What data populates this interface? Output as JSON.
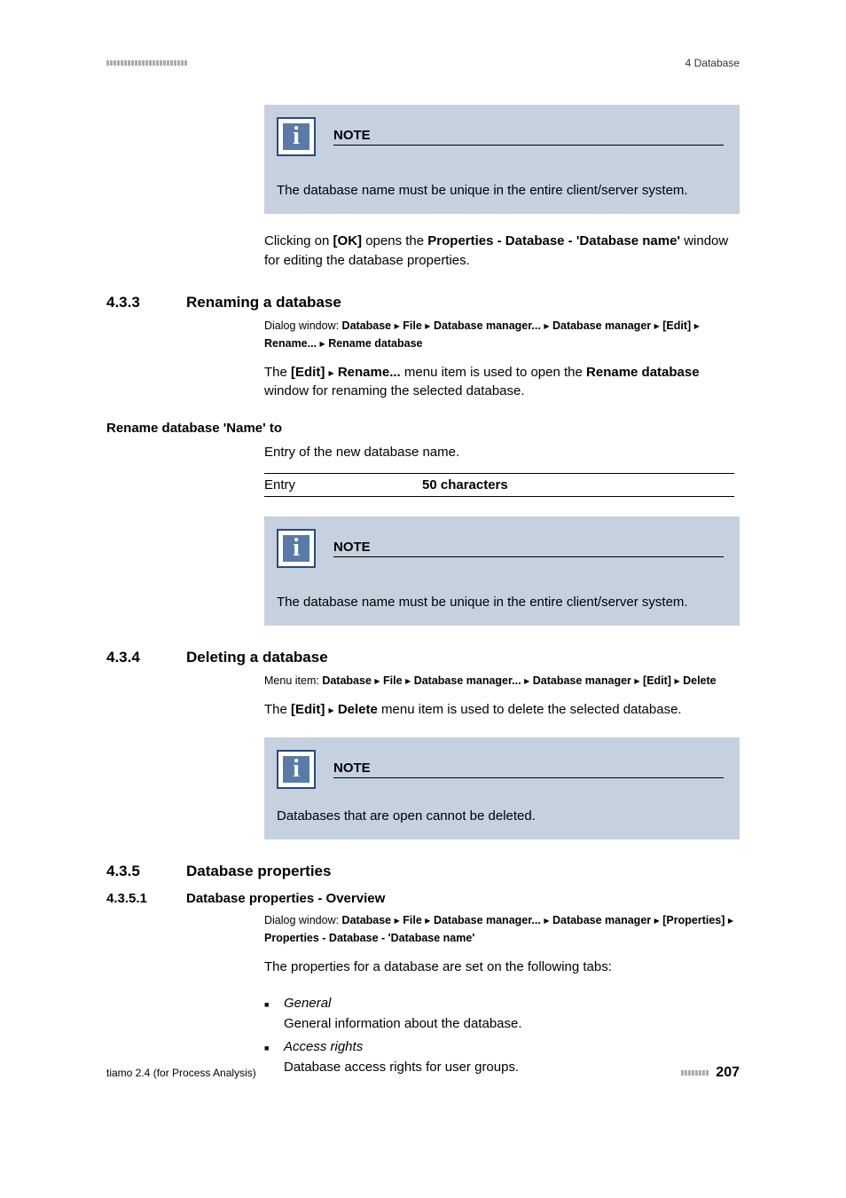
{
  "header": {
    "right": "4 Database"
  },
  "note1": {
    "title": "NOTE",
    "body": "The database name must be unique in the entire client/server system."
  },
  "para1_a": "Clicking on ",
  "para1_ok": "[OK]",
  "para1_b": " opens the ",
  "para1_bold": "Properties - Database - 'Database name'",
  "para1_c": " window for editing the database properties.",
  "sec433": {
    "num": "4.3.3",
    "title": "Renaming a database",
    "path_prefix": "Dialog window: ",
    "path_parts": [
      "Database",
      "File",
      "Database manager...",
      "Database manager",
      "[Edit]",
      "Rename...",
      "Rename database"
    ],
    "p1_a": "The ",
    "p1_b": "[Edit]",
    "p1_c": "Rename...",
    "p1_d": " menu item is used to open the ",
    "p1_e": "Rename database",
    "p1_f": " window for renaming the selected database."
  },
  "subhead1": "Rename database 'Name' to",
  "sub1_desc": "Entry of the new database name.",
  "entry": {
    "label": "Entry",
    "value": "50 characters"
  },
  "note2": {
    "title": "NOTE",
    "body": "The database name must be unique in the entire client/server system."
  },
  "sec434": {
    "num": "4.3.4",
    "title": "Deleting a database",
    "path_prefix": "Menu item: ",
    "path_parts": [
      "Database",
      "File",
      "Database manager...",
      "Database manager",
      "[Edit]",
      "Delete"
    ],
    "p1_a": "The ",
    "p1_b": "[Edit]",
    "p1_c": "Delete",
    "p1_d": " menu item is used to delete the selected database."
  },
  "note3": {
    "title": "NOTE",
    "body": "Databases that are open cannot be deleted."
  },
  "sec435": {
    "num": "4.3.5",
    "title": "Database properties"
  },
  "sec4351": {
    "num": "4.3.5.1",
    "title": "Database properties - Overview",
    "path_prefix": "Dialog window: ",
    "path_parts": [
      "Database",
      "File",
      "Database manager...",
      "Database manager",
      "[Properties]",
      "Properties - Database - 'Database name'"
    ],
    "p1": "The properties for a database are set on the following tabs:",
    "items": [
      {
        "title": "General",
        "desc": "General information about the database."
      },
      {
        "title": "Access rights",
        "desc": "Database access rights for user groups."
      }
    ]
  },
  "footer": {
    "left": "tiamo 2.4 (for Process Analysis)",
    "page": "207"
  }
}
